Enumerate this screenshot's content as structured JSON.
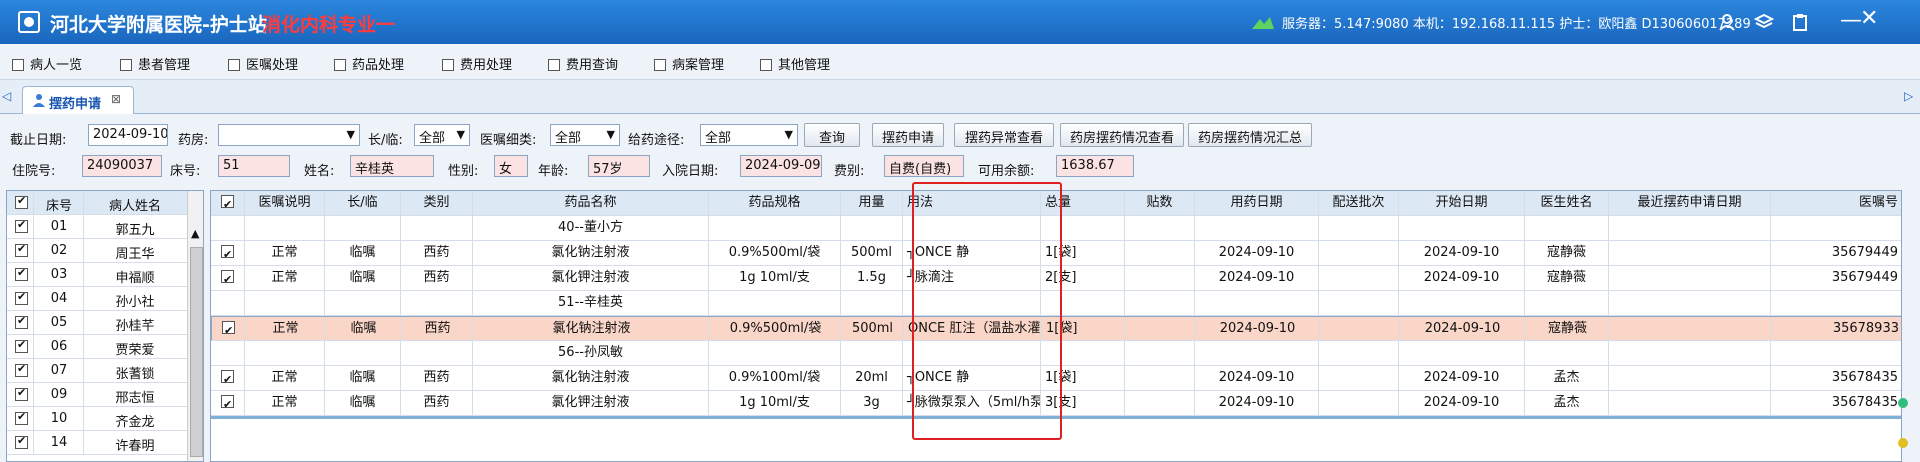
{
  "app": {
    "title": "河北大学附属医院-护士站",
    "subtitle": "消化内科专业一",
    "status": "服务器：5.147:9080 本机：192.168.11.115 护士：欧阳鑫 D130606017289"
  },
  "menu": [
    "病人一览",
    "患者管理",
    "医嘱处理",
    "药品处理",
    "费用处理",
    "费用查询",
    "病案管理",
    "其他管理"
  ],
  "tab": {
    "label": "摆药申请"
  },
  "filters": {
    "date_label": "截止日期:",
    "date_value": "2024-09-10",
    "pharmacy_label": "药房:",
    "pharmacy_value": "",
    "term_label": "长/临:",
    "term_value": "全部",
    "category_label": "医嘱细类:",
    "category_value": "全部",
    "route_label": "给药途径:",
    "route_value": "全部",
    "buttons": [
      "查询",
      "摆药申请",
      "摆药异常查看",
      "药房摆药情况查看",
      "药房摆药情况汇总"
    ]
  },
  "patient_info": {
    "admission_no_label": "住院号:",
    "admission_no": "24090037",
    "bed_label": "床号:",
    "bed": "51",
    "name_label": "姓名:",
    "name": "辛桂英",
    "gender_label": "性别:",
    "gender": "女",
    "age_label": "年龄:",
    "age": "57岁",
    "admit_date_label": "入院日期:",
    "admit_date": "2024-09-09",
    "fee_label": "费别:",
    "fee": "自费(自费)",
    "balance_label": "可用余额:",
    "balance": "1638.67"
  },
  "patient_list": {
    "headers": [
      "床号",
      "病人姓名"
    ],
    "rows": [
      {
        "bed": "01",
        "name": "郭五九"
      },
      {
        "bed": "02",
        "name": "周王华"
      },
      {
        "bed": "03",
        "name": "申福顺"
      },
      {
        "bed": "04",
        "name": "孙小社"
      },
      {
        "bed": "05",
        "name": "孙桂芊"
      },
      {
        "bed": "06",
        "name": "贾荣爱"
      },
      {
        "bed": "07",
        "name": "张蓍锁"
      },
      {
        "bed": "09",
        "name": "邢志恒"
      },
      {
        "bed": "10",
        "name": "齐金龙"
      },
      {
        "bed": "14",
        "name": "许春明"
      }
    ]
  },
  "orders_table": {
    "headers": [
      "医嘱说明",
      "长/临",
      "类别",
      "药品名称",
      "药品规格",
      "用量",
      "用法",
      "总量",
      "贴数",
      "用药日期",
      "配送批次",
      "开始日期",
      "医生姓名",
      "最近摆药申请日期",
      "医嘱号"
    ],
    "groups": [
      {
        "title": "40--董小方",
        "rows": [
          {
            "note": "正常",
            "term": "临嘱",
            "type": "西药",
            "drug": "氯化钠注射液",
            "spec": "0.9%500ml/袋",
            "dose": "500ml",
            "usage": "┐ONCE 静",
            "total": "1[袋]",
            "date": "2024-09-10",
            "start": "2024-09-10",
            "doctor": "寇静薇",
            "order_no": "35679449"
          },
          {
            "note": "正常",
            "term": "临嘱",
            "type": "西药",
            "drug": "氯化钾注射液",
            "spec": "1g 10ml/支",
            "dose": "1.5g",
            "usage": "┘脉滴注",
            "total": "2[支]",
            "date": "2024-09-10",
            "start": "2024-09-10",
            "doctor": "寇静薇",
            "order_no": "35679449"
          }
        ]
      },
      {
        "title": "51--辛桂英",
        "rows": [
          {
            "note": "正常",
            "term": "临嘱",
            "type": "西药",
            "drug": "氯化钠注射液",
            "spec": "0.9%500ml/袋",
            "dose": "500ml",
            "usage": "ONCE 肛注（温盐水灌",
            "total": "1[袋]",
            "date": "2024-09-10",
            "start": "2024-09-10",
            "doctor": "寇静薇",
            "order_no": "35678933"
          }
        ]
      },
      {
        "title": "56--孙凤敏",
        "rows": [
          {
            "note": "正常",
            "term": "临嘱",
            "type": "西药",
            "drug": "氯化钠注射液",
            "spec": "0.9%100ml/袋",
            "dose": "20ml",
            "usage": "┐ONCE 静",
            "total": "1[袋]",
            "date": "2024-09-10",
            "start": "2024-09-10",
            "doctor": "孟杰",
            "order_no": "35678435"
          },
          {
            "note": "正常",
            "term": "临嘱",
            "type": "西药",
            "drug": "氯化钾注射液",
            "spec": "1g 10ml/支",
            "dose": "3g",
            "usage": "┘脉微泵泵入（5ml/h泵",
            "total": "3[支]",
            "date": "2024-09-10",
            "start": "2024-09-10",
            "doctor": "孟杰",
            "order_no": "35678435"
          }
        ]
      }
    ]
  },
  "colors": {
    "titlebar": "#1a66bf",
    "subtitle": "#ff3b3b",
    "selected_row": "#fad6c9",
    "highlight_box": "#e02020"
  }
}
